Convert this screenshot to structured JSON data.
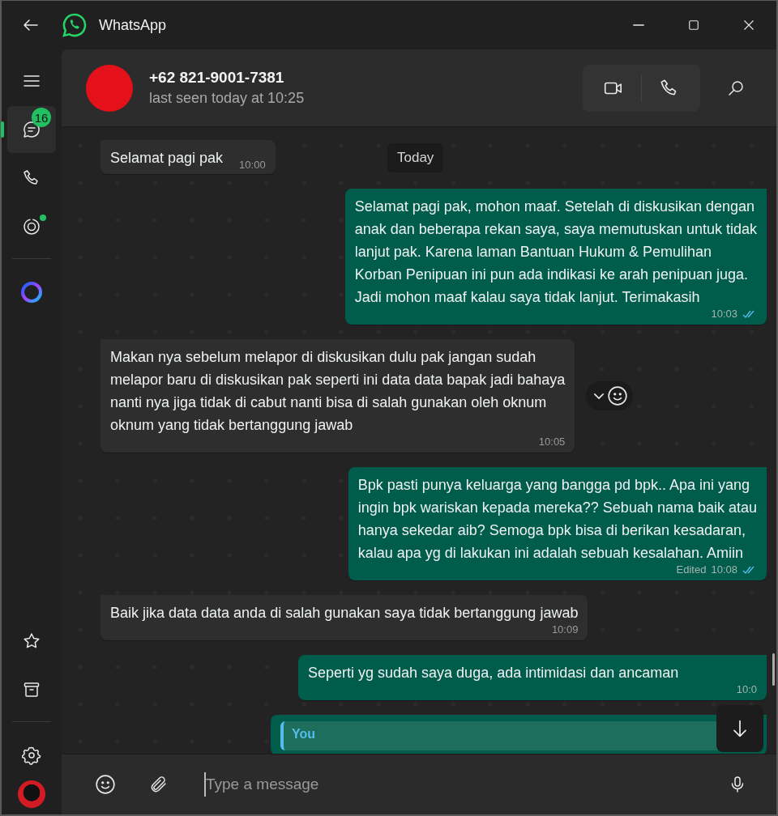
{
  "window": {
    "title": "WhatsApp"
  },
  "sidebar": {
    "top_items": [
      {
        "kind": "menu",
        "selected": false
      },
      {
        "kind": "chats",
        "selected": true,
        "badge": "16"
      },
      {
        "kind": "calls",
        "selected": false
      },
      {
        "kind": "status",
        "selected": false,
        "unread": true
      },
      {
        "kind": "ai",
        "selected": false
      }
    ],
    "bottom_items": [
      {
        "kind": "starred"
      },
      {
        "kind": "archive"
      },
      {
        "kind": "settings"
      },
      {
        "kind": "profile"
      }
    ]
  },
  "chat": {
    "name": "+62 821-9001-7381",
    "status": "last seen today at 10:25",
    "date_chip": "Today",
    "messages": [
      {
        "kind": "in",
        "text": "Selamat pagi pak",
        "time": "10:00"
      },
      {
        "kind": "out",
        "text": "Selamat pagi pak, mohon maaf. Setelah di diskusikan dengan\nanak dan beberapa rekan saya, saya memutuskan untuk tidak\nlanjut pak. Karena laman Bantuan Hukum & Pemulihan\nKorban Penipuan ini pun ada indikasi ke arah penipuan juga.\nJadi mohon maaf kalau saya tidak lanjut. Terimakasih",
        "time": "10:03",
        "read": true
      },
      {
        "kind": "in",
        "text": "Makan nya sebelum melapor di diskusikan dulu pak jangan sudah\nmelapor baru di diskusikan pak seperti ini data data bapak jadi bahaya\nnanti nya jiga tidak di cabut nanti bisa di salah gunakan oleh oknum\noknum yang tidak bertanggung jawab",
        "time": "10:05",
        "hovered": true
      },
      {
        "kind": "out",
        "text": "Bpk pasti punya keluarga yang bangga pd bpk.. Apa ini yang\ningin bpk wariskan kepada mereka?? Sebuah nama baik atau\nhanya sekedar aib? Semoga bpk bisa di berikan kesadaran,\nkalau apa yg di lakukan ini adalah sebuah kesalahan. Amiin",
        "time": "10:08",
        "edited": "Edited",
        "read": true
      },
      {
        "kind": "in",
        "text": "Baik jika data data anda di salah gunakan saya tidak bertanggung jawab",
        "time": "10:09"
      },
      {
        "kind": "out",
        "text": "Seperti yg sudah saya duga, ada intimidasi dan ancaman",
        "time": "10:0"
      },
      {
        "kind": "out",
        "quote_author": "You"
      }
    ]
  },
  "composer": {
    "placeholder": "Type a message"
  }
}
